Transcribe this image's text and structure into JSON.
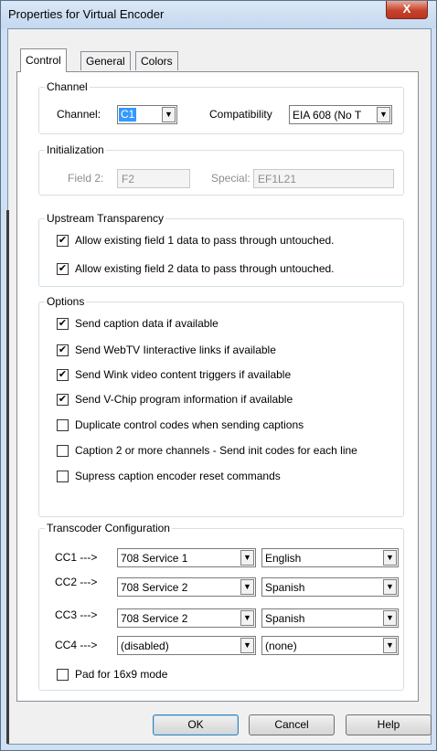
{
  "window": {
    "title": "Properties for Virtual Encoder",
    "close_glyph": "X"
  },
  "tabs": [
    {
      "label": "Control",
      "active": true
    },
    {
      "label": "General",
      "active": false
    },
    {
      "label": "Colors",
      "active": false
    }
  ],
  "channel": {
    "group_label": "Channel",
    "channel_label": "Channel:",
    "channel_value": "C1",
    "compat_label": "Compatibility",
    "compat_value": "EIA 608 (No T"
  },
  "initialization": {
    "group_label": "Initialization",
    "field2_label": "Field 2:",
    "field2_value": "F2",
    "special_label": "Special:",
    "special_value": "EF1L21"
  },
  "upstream": {
    "group_label": "Upstream Transparency",
    "items": [
      {
        "label": "Allow existing field 1 data to pass through untouched.",
        "checked": true
      },
      {
        "label": "Allow existing field 2 data to pass through untouched.",
        "checked": true
      }
    ]
  },
  "options": {
    "group_label": "Options",
    "items": [
      {
        "label": "Send caption data if available",
        "checked": true
      },
      {
        "label": "Send WebTV Iinteractive links if available",
        "checked": true
      },
      {
        "label": "Send Wink video content triggers if available",
        "checked": true
      },
      {
        "label": "Send V-Chip program information if available",
        "checked": true
      },
      {
        "label": "Duplicate control codes when sending captions",
        "checked": false
      },
      {
        "label": "Caption 2 or more channels - Send init codes for each line",
        "checked": false
      },
      {
        "label": "Supress caption encoder reset commands",
        "checked": false
      }
    ]
  },
  "transcoder": {
    "group_label": "Transcoder Configuration",
    "rows": [
      {
        "label": "CC1 --->",
        "service": "708 Service 1",
        "language": "English"
      },
      {
        "label": "CC2 --->",
        "service": "708 Service 2",
        "language": "Spanish"
      },
      {
        "label": "CC3 --->",
        "service": "708 Service 2",
        "language": "Spanish"
      },
      {
        "label": "CC4 --->",
        "service": "(disabled)",
        "language": "(none)"
      }
    ],
    "pad_label": "Pad for 16x9 mode",
    "pad_checked": false
  },
  "buttons": {
    "ok": "OK",
    "cancel": "Cancel",
    "help": "Help"
  },
  "glyphs": {
    "check": "✔",
    "dropdown": "▼"
  }
}
